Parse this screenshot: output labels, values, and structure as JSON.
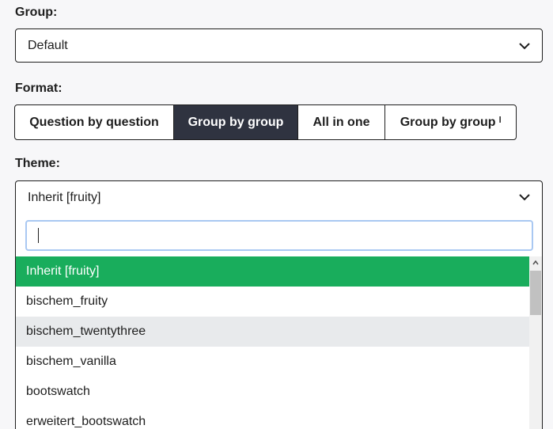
{
  "group": {
    "label": "Group:",
    "value": "Default"
  },
  "format": {
    "label": "Format:",
    "options": [
      {
        "label": "Question by question",
        "active": false
      },
      {
        "label": "Group by group",
        "active": true
      },
      {
        "label": "All in one",
        "active": false
      },
      {
        "label": "Group by group ˡ",
        "active": false
      }
    ]
  },
  "theme": {
    "label": "Theme:",
    "value": "Inherit [fruity]",
    "search_value": "",
    "options": [
      {
        "label": "Inherit [fruity]",
        "state": "selected"
      },
      {
        "label": "bischem_fruity",
        "state": "normal"
      },
      {
        "label": "bischem_twentythree",
        "state": "hover"
      },
      {
        "label": "bischem_vanilla",
        "state": "normal"
      },
      {
        "label": "bootswatch",
        "state": "normal"
      },
      {
        "label": "erweitert_bootswatch",
        "state": "normal"
      }
    ]
  },
  "colors": {
    "selected": "#19ad5c",
    "active_segment": "#2f3340",
    "hover": "#e8eaec",
    "focus_ring": "#a9c8f2"
  },
  "icons": {
    "dropdown": "chevron-down-icon",
    "scroll_up": "chevron-up-icon"
  }
}
